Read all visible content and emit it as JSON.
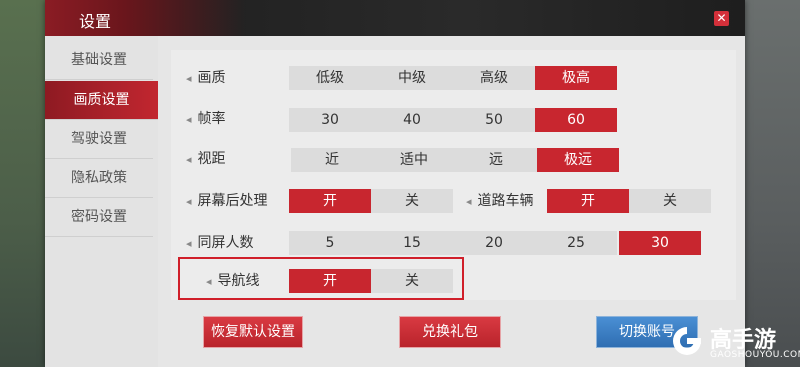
{
  "dialog": {
    "title": "设置",
    "close_icon": "close-icon",
    "close_glyph": "✕"
  },
  "sidebar": {
    "items": [
      {
        "label": "基础设置",
        "active": false
      },
      {
        "label": "画质设置",
        "active": true
      },
      {
        "label": "驾驶设置",
        "active": false
      },
      {
        "label": "隐私政策",
        "active": false
      },
      {
        "label": "密码设置",
        "active": false
      }
    ]
  },
  "settings": {
    "quality": {
      "label": "画质",
      "options": [
        "低级",
        "中级",
        "高级",
        "极高"
      ],
      "selected": "极高"
    },
    "framerate": {
      "label": "帧率",
      "options": [
        "30",
        "40",
        "50",
        "60"
      ],
      "selected": "60"
    },
    "view_distance": {
      "label": "视距",
      "options": [
        "近",
        "适中",
        "远",
        "极远"
      ],
      "selected": "极远"
    },
    "post_processing": {
      "label": "屏幕后处理",
      "options": [
        "开",
        "关"
      ],
      "selected": "开"
    },
    "road_vehicles": {
      "label": "道路车辆",
      "options": [
        "开",
        "关"
      ],
      "selected": "开"
    },
    "same_screen_players": {
      "label": "同屏人数",
      "options": [
        "5",
        "15",
        "20",
        "25",
        "30"
      ],
      "selected": "30"
    },
    "nav_line": {
      "label": "导航线",
      "options": [
        "开",
        "关"
      ],
      "selected": "开"
    }
  },
  "actions": {
    "reset": "恢复默认设置",
    "gift": "兑换礼包",
    "switch_account": "切换账号"
  },
  "watermark": {
    "name": "高手游",
    "domain": "GAOSHOUYOU.COM"
  },
  "colors": {
    "accent_red": "#c8262f",
    "blue_button": "#3a7fc4"
  }
}
